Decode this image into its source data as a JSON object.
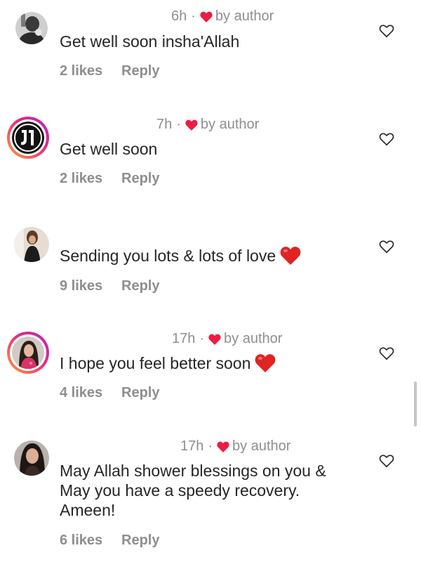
{
  "comments": [
    {
      "time": "6h",
      "dot": "·",
      "badge": "by author",
      "text": "Get well soon insha'Allah",
      "likes": "2 likes",
      "reply": "Reply"
    },
    {
      "time": "7h",
      "dot": "·",
      "badge": "by author",
      "text": "Get well soon",
      "likes": "2 likes",
      "reply": "Reply"
    },
    {
      "text": "Sending you lots & lots of love",
      "emoji": "red-heart-emoji",
      "likes": "9 likes",
      "reply": "Reply"
    },
    {
      "time": "17h",
      "dot": "·",
      "badge": "by author",
      "text": "I hope you feel better soon",
      "emoji": "red-heart-emoji",
      "likes": "4 likes",
      "reply": "Reply"
    },
    {
      "time": "17h",
      "dot": "·",
      "badge": "by author",
      "text_lines": [
        "May Allah shower blessings on you &",
        "May you have a speedy recovery.",
        "Ameen!"
      ],
      "likes": "6 likes",
      "reply": "Reply"
    }
  ],
  "colors": {
    "heart_badge": "#ed1c43",
    "meta_text": "#8e8e8e",
    "comment_text": "#262626",
    "story_ring_start": "#f9a13a",
    "story_ring_end": "#b025c9"
  },
  "icons": {
    "like": "heart-outline-icon",
    "author_like": "heart-filled-icon"
  }
}
